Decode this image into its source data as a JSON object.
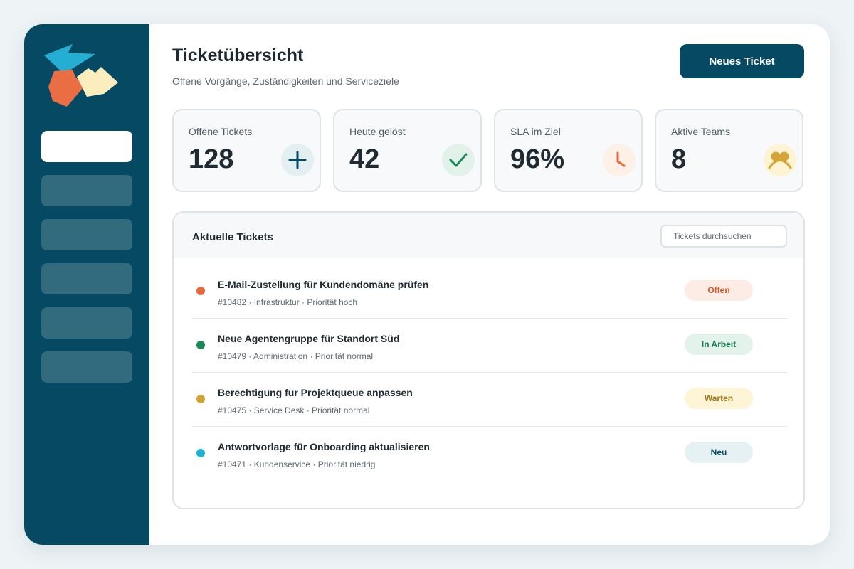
{
  "header": {
    "title": "Ticketübersicht",
    "subtitle": "Offene Vorgänge, Zuständigkeiten und Serviceziele",
    "new_ticket_label": "Neues Ticket"
  },
  "colors": {
    "brand": "#054a62",
    "open": "#e8693f",
    "in_progress": "#1a8a5a",
    "waiting": "#d4a535",
    "new": "#1fb2d9"
  },
  "sidebar": {
    "items": [
      {
        "name": "sidebar-item-1",
        "active": true
      },
      {
        "name": "sidebar-item-2",
        "active": false
      },
      {
        "name": "sidebar-item-3",
        "active": false
      },
      {
        "name": "sidebar-item-4",
        "active": false
      },
      {
        "name": "sidebar-item-5",
        "active": false
      },
      {
        "name": "sidebar-item-6",
        "active": false
      }
    ]
  },
  "kpis": [
    {
      "label": "Offene Tickets",
      "value": "128",
      "icon": "plus-icon"
    },
    {
      "label": "Heute gelöst",
      "value": "42",
      "icon": "check-icon"
    },
    {
      "label": "SLA im Ziel",
      "value": "96%",
      "icon": "clock-icon"
    },
    {
      "label": "Aktive Teams",
      "value": "8",
      "icon": "team-icon"
    }
  ],
  "tickets": {
    "title": "Aktuelle Tickets",
    "search_placeholder": "Tickets durchsuchen",
    "rows": [
      {
        "title": "E-Mail-Zustellung für Kundendomäne prüfen",
        "meta": "#10482 · Infrastruktur · Priorität hoch",
        "status": "Offen",
        "status_key": "open"
      },
      {
        "title": "Neue Agentengruppe für Standort Süd",
        "meta": "#10479 · Administration · Priorität normal",
        "status": "In Arbeit",
        "status_key": "in_progress"
      },
      {
        "title": "Berechtigung für Projektqueue anpassen",
        "meta": "#10475 · Service Desk · Priorität normal",
        "status": "Warten",
        "status_key": "waiting"
      },
      {
        "title": "Antwortvorlage für Onboarding aktualisieren",
        "meta": "#10471 · Kundenservice · Priorität niedrig",
        "status": "Neu",
        "status_key": "new"
      }
    ]
  }
}
